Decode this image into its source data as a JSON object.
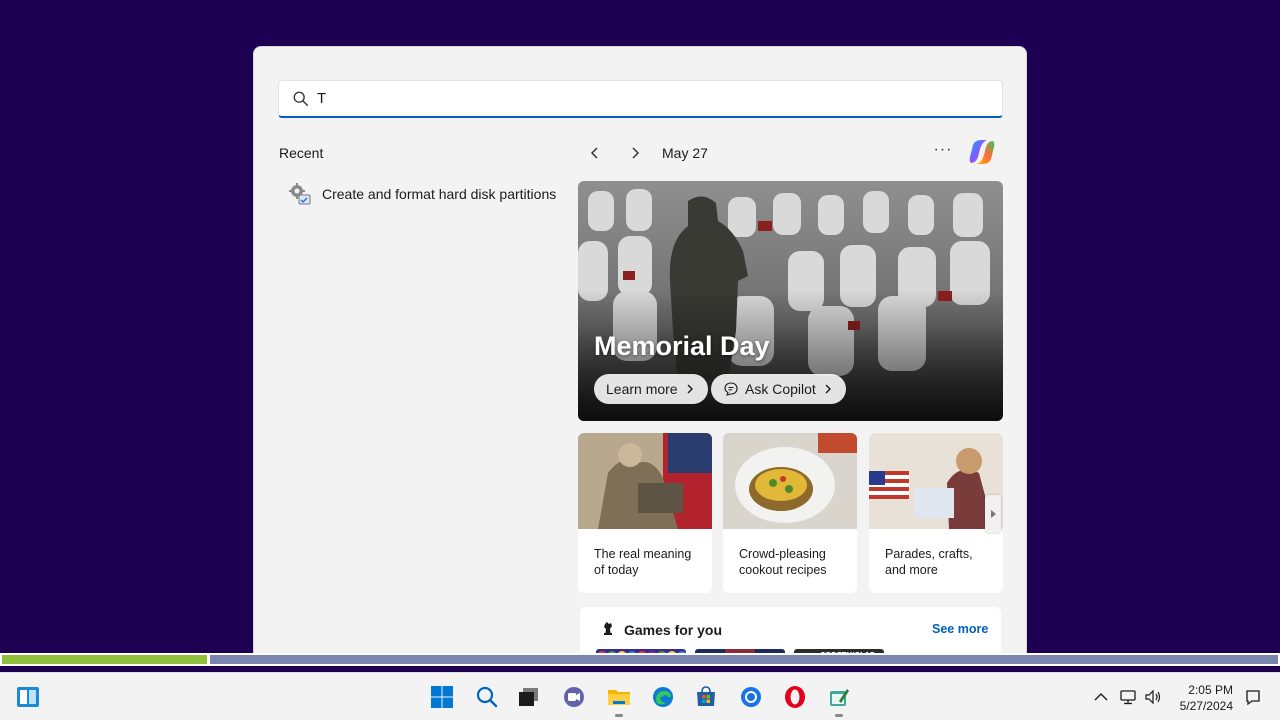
{
  "search": {
    "value": "T",
    "placeholder": ""
  },
  "recent": {
    "title": "Recent",
    "items": [
      {
        "label": "Create and format hard disk partitions",
        "icon": "disk-management-icon"
      }
    ]
  },
  "highlights": {
    "date": "May 27",
    "hero": {
      "title": "Memorial Day",
      "learn_more": "Learn more",
      "ask_copilot": "Ask Copilot"
    },
    "cards": [
      {
        "caption": "The real meaning of today"
      },
      {
        "caption": "Crowd-pleasing cookout recipes"
      },
      {
        "caption": "Parades, crafts, and more"
      }
    ],
    "games": {
      "title": "Games for you",
      "see_more": "See more",
      "tiles": [
        {
          "label": ""
        },
        {
          "label": ""
        },
        {
          "label": "CODETHISLAB"
        }
      ]
    }
  },
  "taskbar": {
    "time": "2:05 PM",
    "date": "5/27/2024",
    "apps": [
      "start-icon",
      "search-icon",
      "task-view-icon",
      "teams-icon",
      "file-explorer-icon",
      "edge-icon",
      "store-icon",
      "chrome-icon",
      "opera-icon",
      "notepad-icon"
    ]
  },
  "colors": {
    "desktop": "#1e0052",
    "accent": "#005fb8",
    "progress_green": "#8fbf3a",
    "progress_blue": "#7a86b0"
  }
}
